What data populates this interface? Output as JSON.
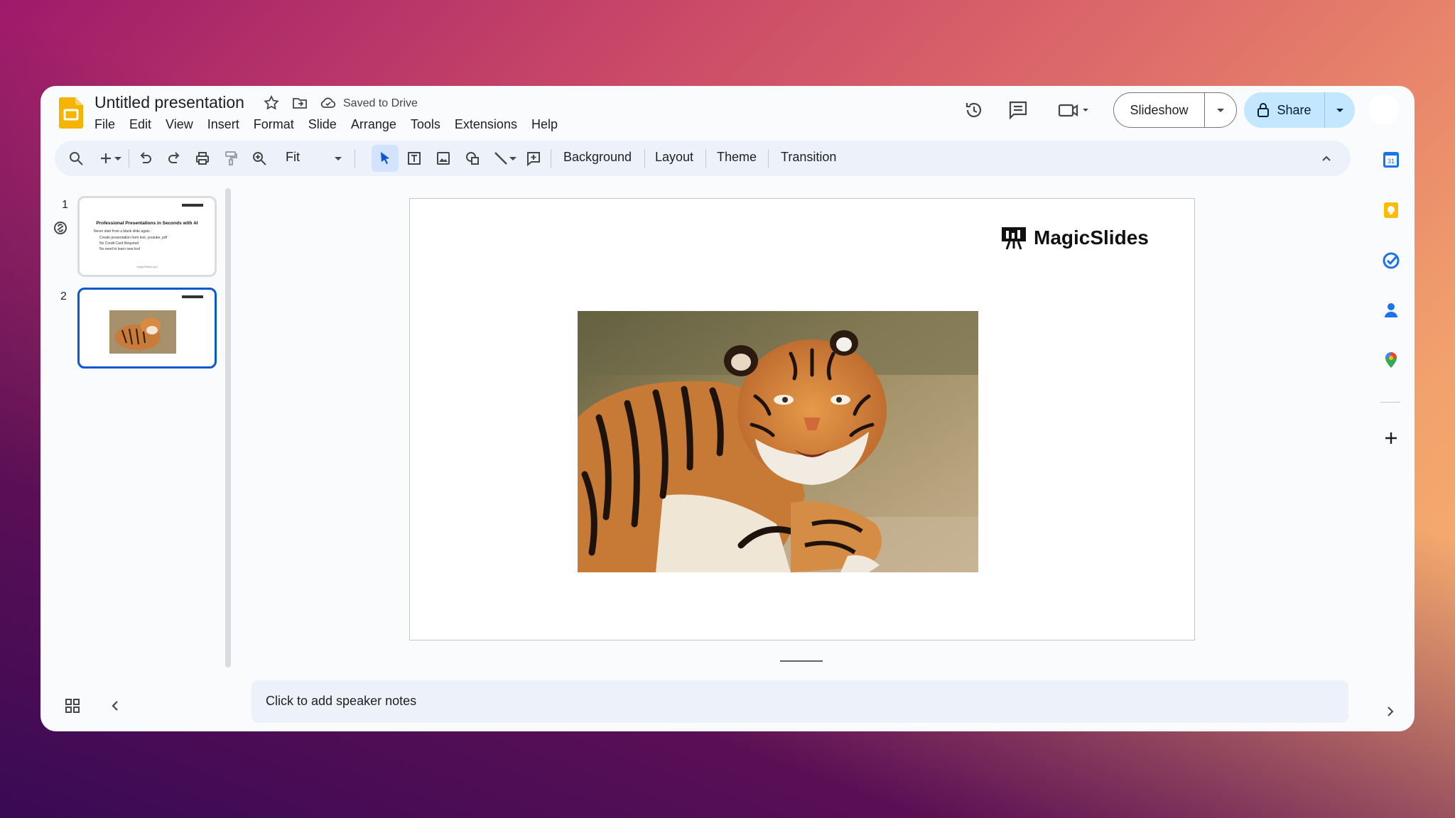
{
  "app": {
    "title": "Untitled presentation",
    "save_status": "Saved to Drive"
  },
  "menu": [
    "File",
    "Edit",
    "View",
    "Insert",
    "Format",
    "Slide",
    "Arrange",
    "Tools",
    "Extensions",
    "Help"
  ],
  "header_buttons": {
    "slideshow": "Slideshow",
    "share": "Share"
  },
  "toolbar": {
    "zoom": "Fit",
    "background": "Background",
    "layout": "Layout",
    "theme": "Theme",
    "transition": "Transition"
  },
  "filmstrip": {
    "slides": [
      {
        "number": "1",
        "title": "Professional Presentations in Seconds with AI",
        "subtitle": "Never start from a blank slide again.",
        "bullets": [
          "Create presentation from text, youtube, pdf",
          "No Credit Card Required",
          "No need to learn new tool"
        ],
        "footer": "MagicSlides app"
      },
      {
        "number": "2"
      }
    ]
  },
  "slide": {
    "brand": "MagicSlides",
    "image_subject": "tiger"
  },
  "notes": {
    "placeholder": "Click to add speaker notes"
  },
  "side_panel": [
    "calendar-icon",
    "keep-icon",
    "tasks-icon",
    "contacts-icon",
    "maps-icon",
    "add-icon"
  ],
  "colors": {
    "accent": "#0b57d0",
    "share_bg": "#c2e7ff",
    "toolbar_bg": "#edf2fa",
    "slides_yellow": "#f4b400"
  }
}
